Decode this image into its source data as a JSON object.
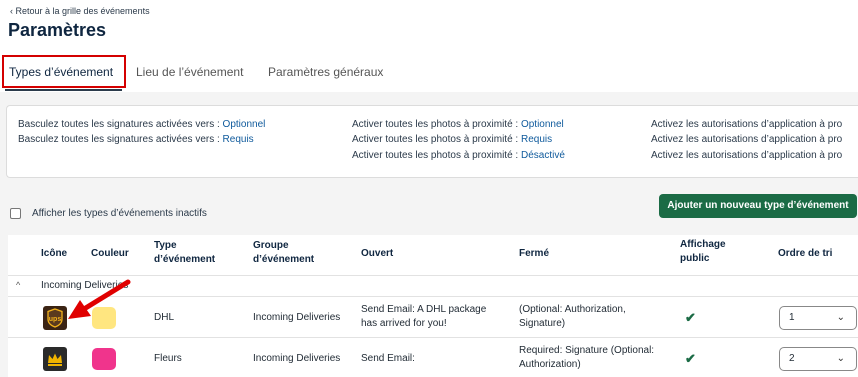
{
  "header": {
    "back_link": "‹ Retour à la grille des événements",
    "title": "Paramètres",
    "tabs": [
      "Types d’événement",
      "Lieu de l’événement",
      "Paramètres généraux"
    ]
  },
  "settings": {
    "col1": [
      {
        "label": "Basculez toutes les signatures activées vers : ",
        "value": "Optionnel"
      },
      {
        "label": "Basculez toutes les signatures activées vers : ",
        "value": "Requis"
      }
    ],
    "col2": [
      {
        "label": "Activer toutes les photos à proximité : ",
        "value": "Optionnel"
      },
      {
        "label": "Activer toutes les photos à proximité : ",
        "value": "Requis"
      },
      {
        "label": "Activer toutes les photos à proximité : ",
        "value": "Désactivé"
      }
    ],
    "col3": [
      {
        "label": "Activez les autorisations d’application à pro"
      },
      {
        "label": "Activez les autorisations d’application à pro"
      },
      {
        "label": "Activez les autorisations d’application à pro"
      }
    ]
  },
  "toolbar": {
    "show_inactive_label": "Afficher les types d’événements inactifs",
    "add_button": "Ajouter un nouveau type d’événement"
  },
  "table": {
    "columns": {
      "icon": "Icône",
      "color": "Couleur",
      "type_l1": "Type",
      "type_l2": "d’événement",
      "group_l1": "Groupe",
      "group_l2": "d’événement",
      "open": "Ouvert",
      "closed": "Fermé",
      "public_l1": "Affichage",
      "public_l2": "public",
      "sort": "Ordre de tri"
    },
    "group": "Incoming Deliveries",
    "rows": [
      {
        "icon": "ups-logo-icon",
        "icon_text": "ups",
        "swatch_color": "#ffe680",
        "type": "DHL",
        "group": "Incoming Deliveries",
        "open_l1": "Send Email: A DHL package",
        "open_l2": "has arrived for you!",
        "closed_l1": "(Optional: Authorization,",
        "closed_l2": "Signature)",
        "public": "✔",
        "sort": "1"
      },
      {
        "icon": "crown-logo-icon",
        "icon_text": "♛",
        "swatch_color": "#f0348c",
        "type": "Fleurs",
        "group": "Incoming Deliveries",
        "open_l1": "Send Email:",
        "open_l2": "",
        "closed_l1": "Required: Signature (Optional:",
        "closed_l2": "Authorization)",
        "public": "✔",
        "sort": "2"
      }
    ]
  },
  "colors": {
    "accent_green": "#1b6b45",
    "link_blue": "#0f5a9c",
    "highlight_red": "#d40000"
  }
}
